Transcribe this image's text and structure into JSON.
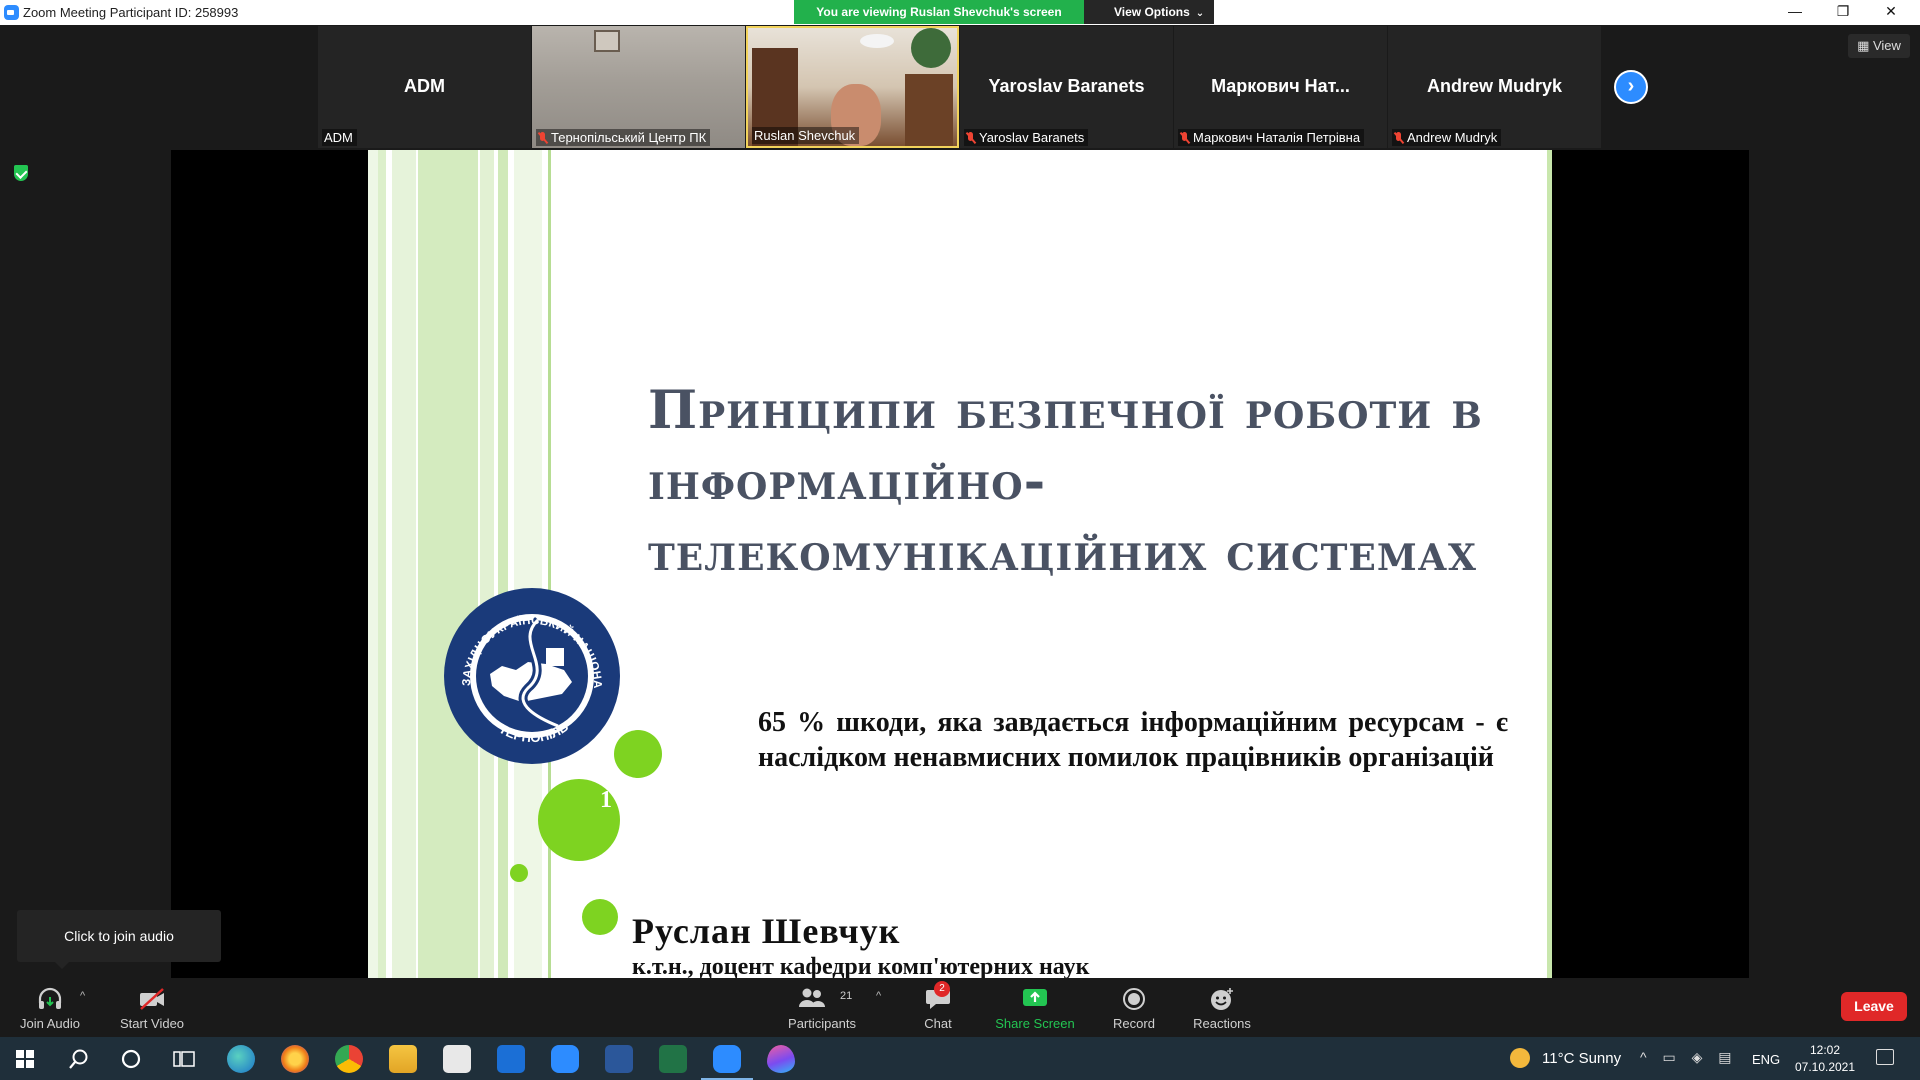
{
  "window": {
    "title": "Zoom Meeting Participant ID: 258993",
    "banner": "You are viewing Ruslan Shevchuk's screen",
    "view_options": "View Options",
    "minimize": "—",
    "restore": "❐",
    "close": "✕"
  },
  "participants": [
    {
      "big_name": "ADM",
      "label": "ADM",
      "muted": false,
      "video": false
    },
    {
      "big_name": "",
      "label": "Тернопільський Центр ПК",
      "muted": true,
      "video": true
    },
    {
      "big_name": "",
      "label": "Ruslan Shevchuk",
      "muted": false,
      "video": true,
      "active_speaker": true
    },
    {
      "big_name": "Yaroslav Baranets",
      "label": "Yaroslav Baranets",
      "muted": true,
      "video": false
    },
    {
      "big_name": "Маркович Нат...",
      "label": "Маркович Наталія Петрівна",
      "muted": true,
      "video": false
    },
    {
      "big_name": "Andrew Mudryk",
      "label": "Andrew Mudryk",
      "muted": true,
      "video": false
    }
  ],
  "view_button": "View",
  "slide": {
    "title": "Принципи безпечної роботи в інформаційно-телекомунікаційних системах",
    "quote": "65 % шкоди, яка завдається інформаційним ресурсам - є наслідком ненавмисних помилок працівників організацій",
    "number": "1",
    "author": "Руслан Шевчук",
    "position": "к.т.н., доцент кафедри комп'ютерних наук",
    "seal_text_top": "ЗАХІДНОУКРАЇНСЬКИЙ НАЦІОНАЛЬНИЙ УНІВЕРСИТЕТ",
    "seal_text_bottom": "ТЕРНОПІЛЬ"
  },
  "tooltip": "Click to join audio",
  "controls": {
    "join_audio": "Join Audio",
    "start_video": "Start Video",
    "participants": "Participants",
    "participants_count": "21",
    "chat": "Chat",
    "chat_badge": "2",
    "share_screen": "Share Screen",
    "record": "Record",
    "reactions": "Reactions",
    "leave": "Leave"
  },
  "taskbar": {
    "weather": "11°C  Sunny",
    "lang": "ENG",
    "time": "12:02",
    "date": "07.10.2021"
  },
  "colors": {
    "zoom_blue": "#2d8cff",
    "banner_green": "#22b14c",
    "leave_red": "#e02828",
    "slide_green": "#7ed321",
    "title_gray": "#4a5263",
    "seal_navy": "#1a3a7a"
  }
}
